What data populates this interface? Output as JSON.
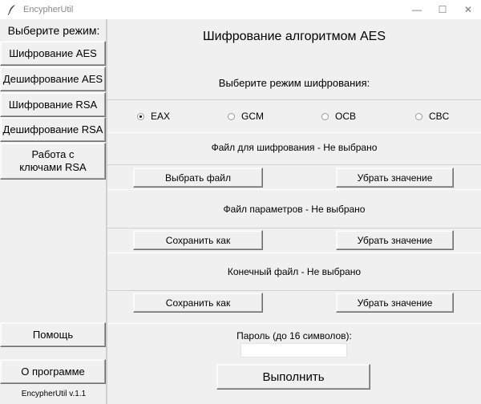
{
  "window": {
    "title": "EncypherUtil",
    "minimize": "—",
    "maximize": "☐",
    "close": "✕"
  },
  "sidebar": {
    "heading": "Выберите режим:",
    "items": [
      {
        "label": "Шифрование AES"
      },
      {
        "label": "Дешифрование AES"
      },
      {
        "label": "Шифрование RSA"
      },
      {
        "label": "Дешифрование RSA"
      },
      {
        "label": "Работа с ключами RSA"
      }
    ],
    "help": "Помощь",
    "about": "О программе",
    "version": "EncypherUtil v.1.1"
  },
  "main": {
    "title": "Шифрование алгоритмом AES",
    "mode_label": "Выберите режим шифрования:",
    "modes": [
      {
        "label": "EAX",
        "selected": true
      },
      {
        "label": "GCM",
        "selected": false
      },
      {
        "label": "OCB",
        "selected": false
      },
      {
        "label": "CBC",
        "selected": false
      }
    ],
    "file_to_encrypt": {
      "label": "Файл для шифрования - Не выбрано",
      "choose_button": "Выбрать файл",
      "clear_button": "Убрать значение"
    },
    "params_file": {
      "label": "Файл параметров - Не выбрано",
      "save_button": "Сохранить как",
      "clear_button": "Убрать значение"
    },
    "output_file": {
      "label": "Конечный файл - Не выбрано",
      "save_button": "Сохранить как",
      "clear_button": "Убрать значение"
    },
    "password": {
      "label": "Пароль (до 16 символов):",
      "value": ""
    },
    "run_button": "Выполнить"
  }
}
